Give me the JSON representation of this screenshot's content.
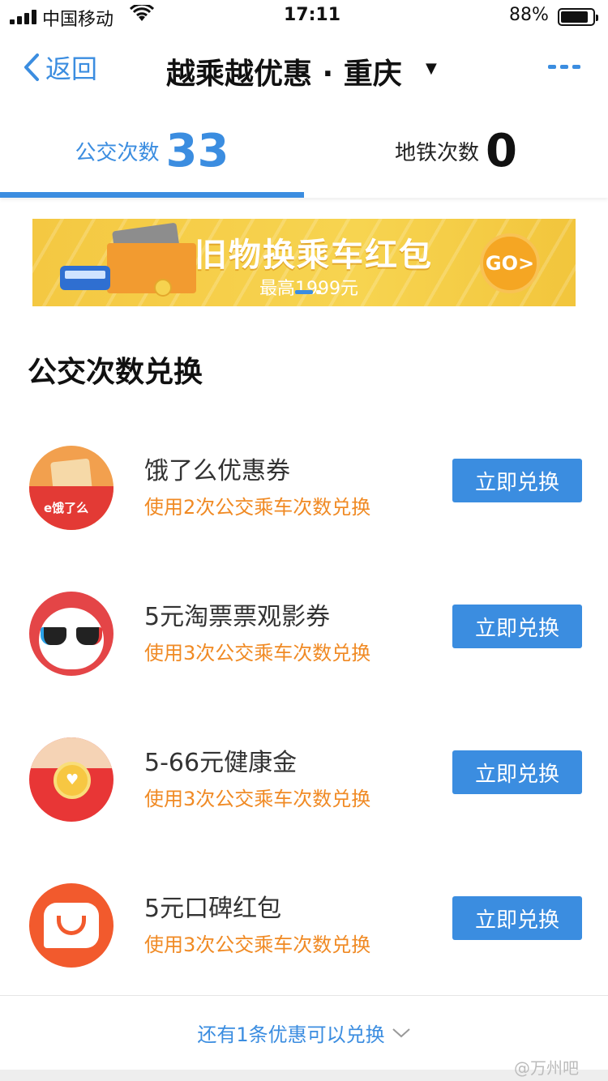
{
  "status_bar": {
    "carrier": "中国移动",
    "time": "17:11",
    "battery": "88%"
  },
  "nav": {
    "back_label": "返回",
    "title": "越乘越优惠 · 重庆",
    "caret": "▼",
    "more_icon": "ellipsis-icon"
  },
  "tabs": [
    {
      "label": "公交次数",
      "count": "33",
      "active": true
    },
    {
      "label": "地铁次数",
      "count": "0",
      "active": false
    }
  ],
  "banner": {
    "title": "旧物换乘车红包",
    "subtitle": "最高1999元",
    "go_label": "GO>"
  },
  "section_title": "公交次数兑换",
  "offers": [
    {
      "name": "饿了么优惠券",
      "desc": "使用2次公交乘车次数兑换",
      "button": "立即兑换",
      "icon": "eleme-coupon-icon",
      "icon_text": "e饿了么"
    },
    {
      "name": "5元淘票票观影券",
      "desc": "使用3次公交乘车次数兑换",
      "button": "立即兑换",
      "icon": "taopiaopiao-icon"
    },
    {
      "name": "5-66元健康金",
      "desc": "使用3次公交乘车次数兑换",
      "button": "立即兑换",
      "icon": "health-red-envelope-icon"
    },
    {
      "name": "5元口碑红包",
      "desc": "使用3次公交乘车次数兑换",
      "button": "立即兑换",
      "icon": "koubei-icon"
    }
  ],
  "footer": {
    "more_label": "还有1条优惠可以兑换"
  },
  "watermark": "@万州吧",
  "colors": {
    "accent": "#3b8de0",
    "orange_text": "#f08a24"
  }
}
